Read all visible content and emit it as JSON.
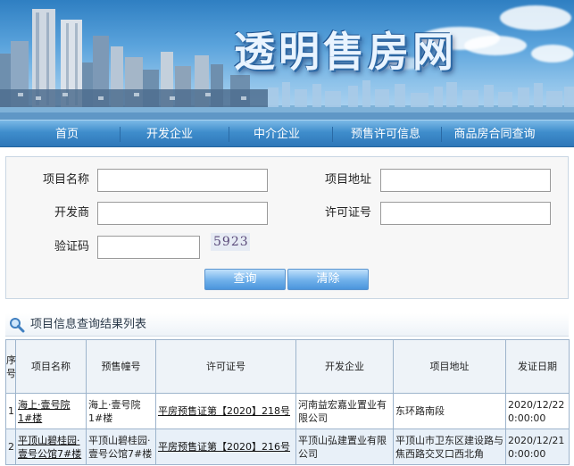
{
  "banner": {
    "title": "透明售房网"
  },
  "nav": [
    "首页",
    "开发企业",
    "中介企业",
    "预售许可信息",
    "商品房合同查询"
  ],
  "search": {
    "project_name_label": "项目名称",
    "project_address_label": "项目地址",
    "developer_label": "开发商",
    "permit_label": "许可证号",
    "captcha_label": "验证码",
    "captcha_text": "5923",
    "project_name_value": "",
    "project_address_value": "",
    "developer_value": "",
    "permit_value": "",
    "captcha_value": "",
    "query_button": "查询",
    "clear_button": "清除"
  },
  "results": {
    "title": "项目信息查询结果列表",
    "columns": [
      "序号",
      "项目名称",
      "预售幢号",
      "许可证号",
      "开发企业",
      "项目地址",
      "发证日期"
    ],
    "rows": [
      {
        "no": "1",
        "project": "海上·壹号院1#楼",
        "building": "海上·壹号院1#楼",
        "permit": "平房预售证第【2020】218号",
        "developer": "河南益宏嘉业置业有限公司",
        "address": "东环路南段",
        "date": "2020/12/22 0:00:00"
      },
      {
        "no": "2",
        "project": "平顶山碧桂园·壹号公馆7#楼",
        "building": "平顶山碧桂园·壹号公馆7#楼",
        "permit": "平房预售证第【2020】216号",
        "developer": "平顶山弘建置业有限公司",
        "address": "平顶山市卫东区建设路与焦西路交叉口西北角",
        "date": "2020/12/21 0:00:00"
      }
    ]
  },
  "colors": {
    "nav_bg": "#3f8dcc",
    "banner_sky": "#5aa3dc",
    "button_blue": "#4b95dc",
    "table_border": "#9db4cc",
    "alt_row": "#e8f0f8"
  }
}
